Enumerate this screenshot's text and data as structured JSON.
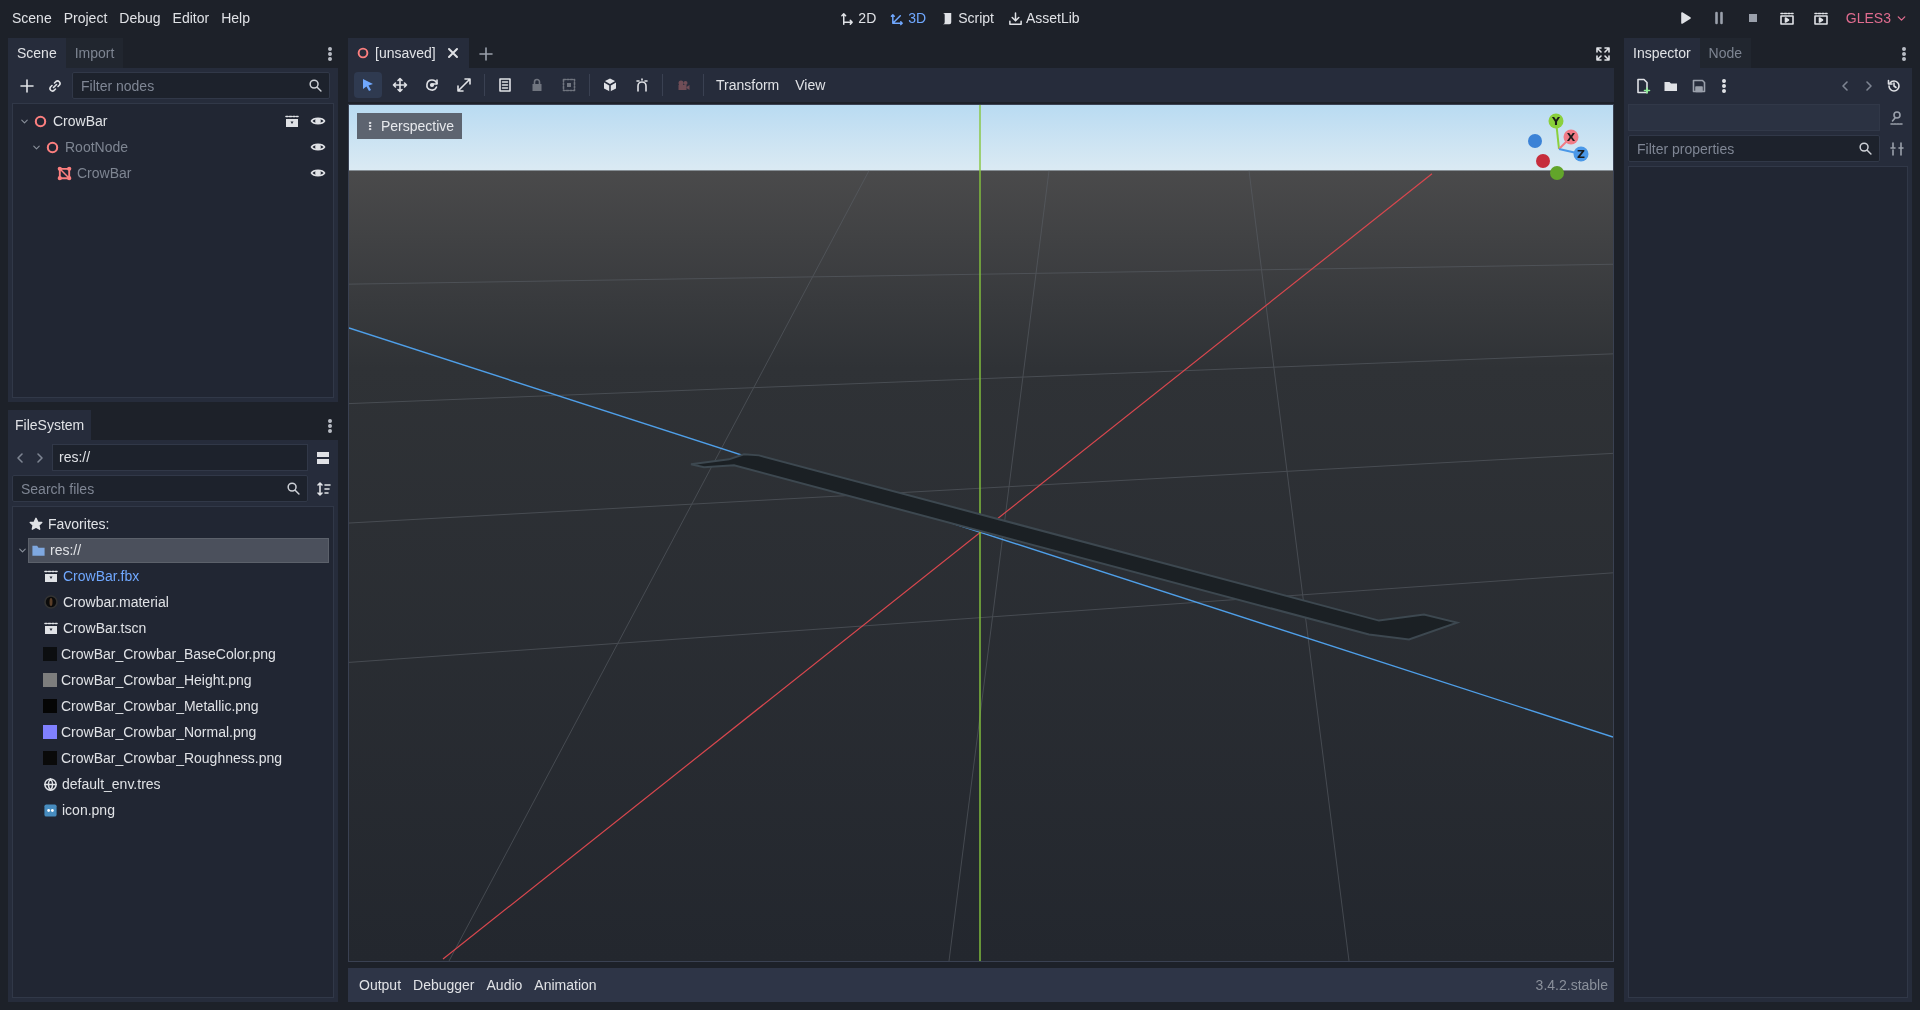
{
  "menu": [
    "Scene",
    "Project",
    "Debug",
    "Editor",
    "Help"
  ],
  "workspaces": [
    {
      "label": "2D",
      "kind": "twod",
      "selected": false
    },
    {
      "label": "3D",
      "kind": "threed",
      "selected": true
    },
    {
      "label": "Script",
      "kind": "script",
      "selected": false
    },
    {
      "label": "AssetLib",
      "kind": "assetlib",
      "selected": false
    }
  ],
  "renderer": "GLES3",
  "scene_dock": {
    "tabs": [
      {
        "label": "Scene",
        "selected": true
      },
      {
        "label": "Import",
        "selected": false
      }
    ],
    "filter": {
      "placeholder": "Filter nodes"
    },
    "tree": [
      {
        "name": "CrowBar",
        "kind": "spatial",
        "dimmed": false,
        "instanced": true,
        "visible": true,
        "expanded": true,
        "children": [
          {
            "name": "RootNode",
            "kind": "spatial",
            "dimmed": true,
            "instanced": false,
            "visible": true,
            "expanded": true,
            "children": [
              {
                "name": "CrowBar",
                "kind": "mesh",
                "dimmed": true,
                "instanced": false,
                "visible": true
              }
            ]
          }
        ]
      }
    ]
  },
  "filesystem": {
    "title": "FileSystem",
    "path": "res://",
    "search": {
      "placeholder": "Search files"
    },
    "favorites": "Favorites:",
    "root": {
      "name": "res://",
      "selected": true,
      "expanded": true
    },
    "files": [
      {
        "name": "CrowBar.fbx",
        "kind": "scene",
        "current": true
      },
      {
        "name": "Crowbar.material",
        "kind": "material",
        "current": false
      },
      {
        "name": "CrowBar.tscn",
        "kind": "scene",
        "current": false
      },
      {
        "name": "CrowBar_Crowbar_BaseColor.png",
        "color": "#0c0e10",
        "current": false
      },
      {
        "name": "CrowBar_Crowbar_Height.png",
        "color": "#7d7d7d",
        "current": false
      },
      {
        "name": "CrowBar_Crowbar_Metallic.png",
        "color": "#050505",
        "current": false
      },
      {
        "name": "CrowBar_Crowbar_Normal.png",
        "color": "#8080ff",
        "current": false
      },
      {
        "name": "CrowBar_Crowbar_Roughness.png",
        "color": "#0a0a0a",
        "current": false
      },
      {
        "name": "default_env.tres",
        "kind": "environment",
        "current": false
      },
      {
        "name": "icon.png",
        "kind": "icon",
        "current": false
      }
    ]
  },
  "editor_tabs": [
    {
      "label": "[unsaved]",
      "selected": true
    }
  ],
  "tools": [
    {
      "kind": "select",
      "selected": true,
      "disabled": false
    },
    {
      "kind": "move",
      "selected": false,
      "disabled": false
    },
    {
      "kind": "rotate",
      "selected": false,
      "disabled": false
    },
    {
      "kind": "scale",
      "selected": false,
      "disabled": false
    },
    {
      "kind": "list",
      "selected": false,
      "disabled": false
    },
    {
      "kind": "lock",
      "selected": false,
      "disabled": true
    },
    {
      "kind": "group",
      "selected": false,
      "disabled": true
    },
    {
      "kind": "local",
      "selected": false,
      "disabled": false
    },
    {
      "kind": "snap",
      "selected": false,
      "disabled": false
    },
    {
      "kind": "camera",
      "selected": false,
      "disabled": true
    }
  ],
  "toolbar_menus": [
    "Transform",
    "View"
  ],
  "viewport": {
    "kind": "picture",
    "perspective": "Perspective",
    "gizmo": [
      "Y",
      "X",
      "Z"
    ]
  },
  "bottom_panel": {
    "tabs": [
      "Output",
      "Debugger",
      "Audio",
      "Animation"
    ],
    "version": "3.4.2.stable"
  },
  "inspector": {
    "tabs": [
      {
        "label": "Inspector",
        "selected": true
      },
      {
        "label": "Node",
        "selected": false
      }
    ],
    "filter": {
      "placeholder": "Filter properties"
    }
  }
}
